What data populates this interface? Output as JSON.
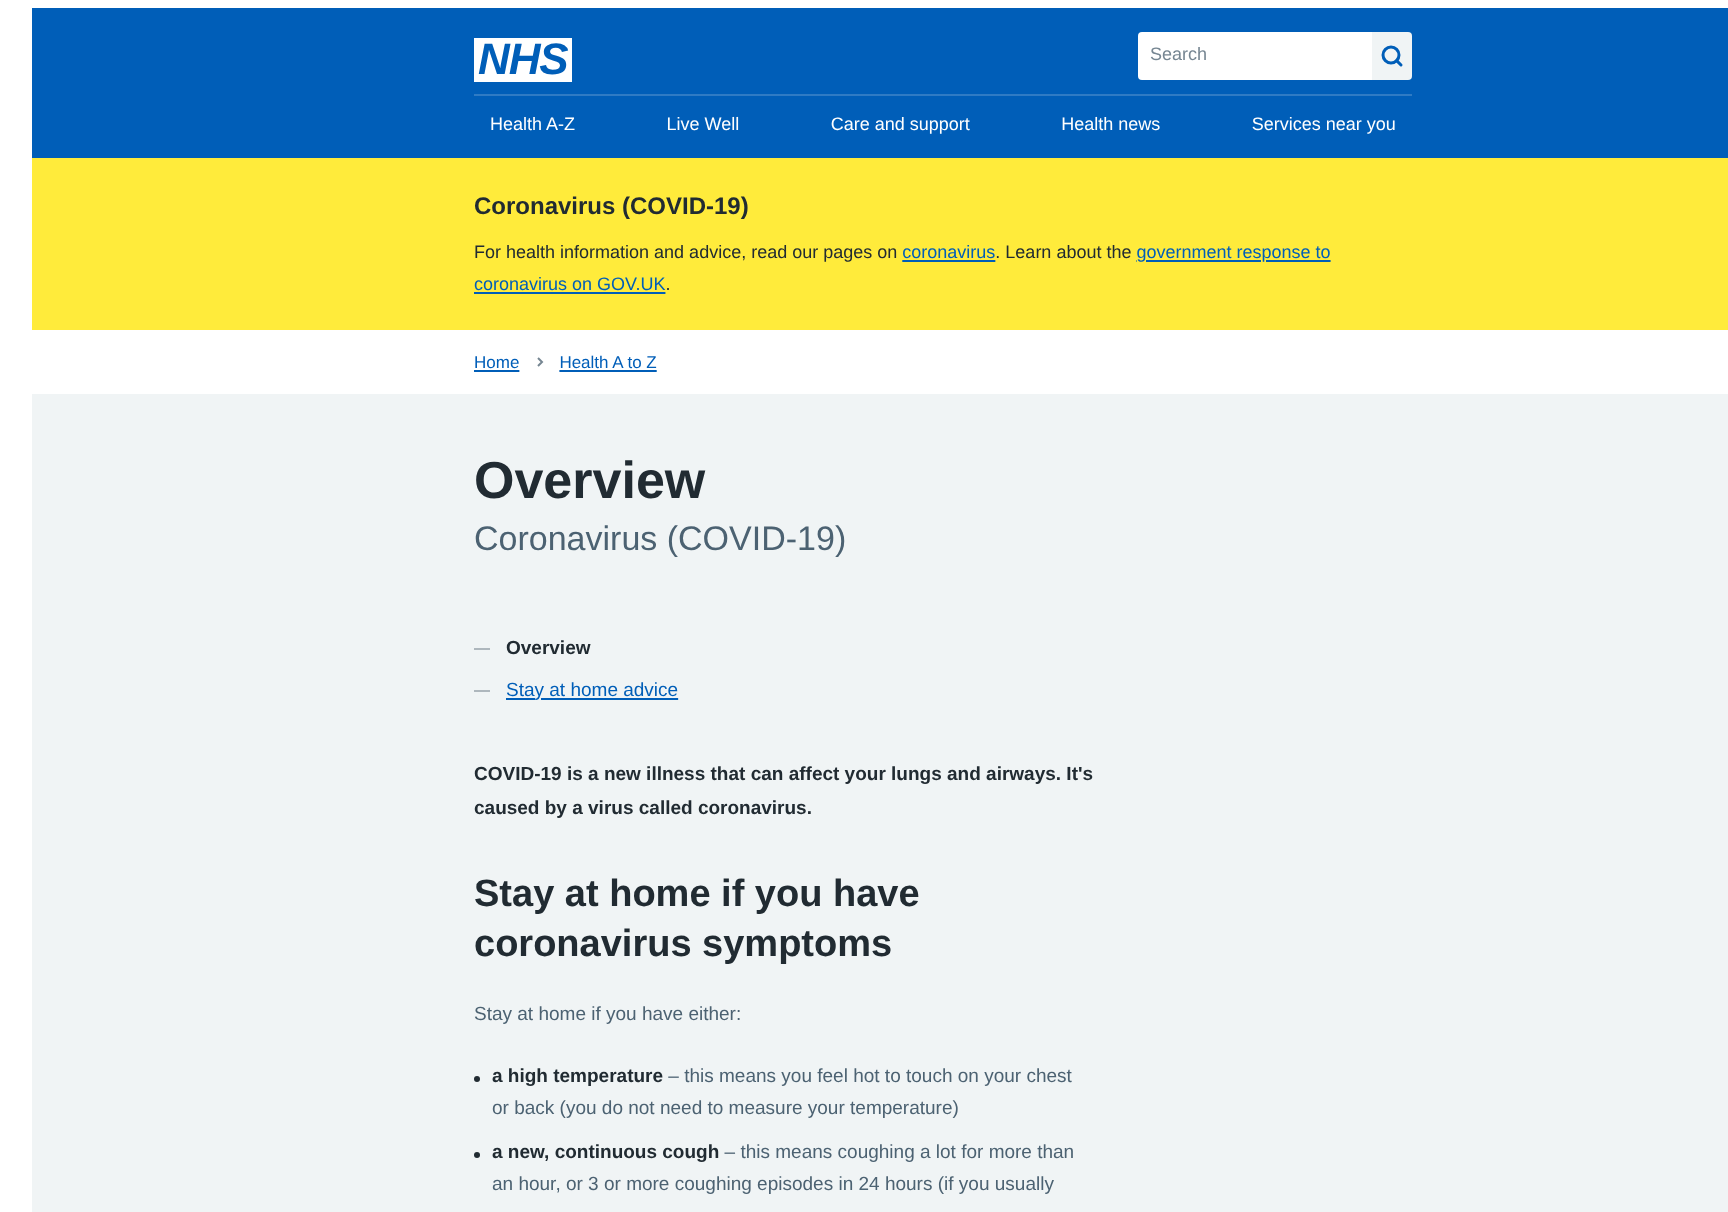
{
  "header": {
    "logo": "NHS",
    "search": {
      "placeholder": "Search"
    },
    "nav": [
      "Health A-Z",
      "Live Well",
      "Care and support",
      "Health news",
      "Services near you"
    ]
  },
  "banner": {
    "title": "Coronavirus (COVID-19)",
    "parts": [
      {
        "kind": "text",
        "text": "For health information and advice, read our pages on "
      },
      {
        "kind": "link",
        "text": "coronavirus"
      },
      {
        "kind": "text",
        "text": ". Learn about the "
      },
      {
        "kind": "link",
        "text": "government response to",
        "line_break_after": true
      },
      {
        "kind": "link",
        "text": "coronavirus on GOV.UK"
      },
      {
        "kind": "text",
        "text": "."
      }
    ]
  },
  "breadcrumb": [
    "Home",
    "Health A to Z"
  ],
  "page": {
    "title": "Overview",
    "subtitle": "Coronavirus (COVID-19)",
    "contents": [
      {
        "label": "Overview",
        "selected": true
      },
      {
        "label": "Stay at home advice",
        "selected": false
      }
    ],
    "intro": "COVID-19 is a new illness that can affect your lungs and airways. It's caused by a virus called coronavirus.",
    "heading": "Stay at home if you have coronavirus symptoms",
    "lead": "Stay at home if you have either:",
    "bullets": [
      "**a high temperature** – this means you feel hot to touch on your chest or back (you do not need to measure your temperature)",
      "**a new, continuous cough** – this means coughing a lot for more than an hour, or 3 or more coughing episodes in 24 hours (if you usually"
    ]
  }
}
